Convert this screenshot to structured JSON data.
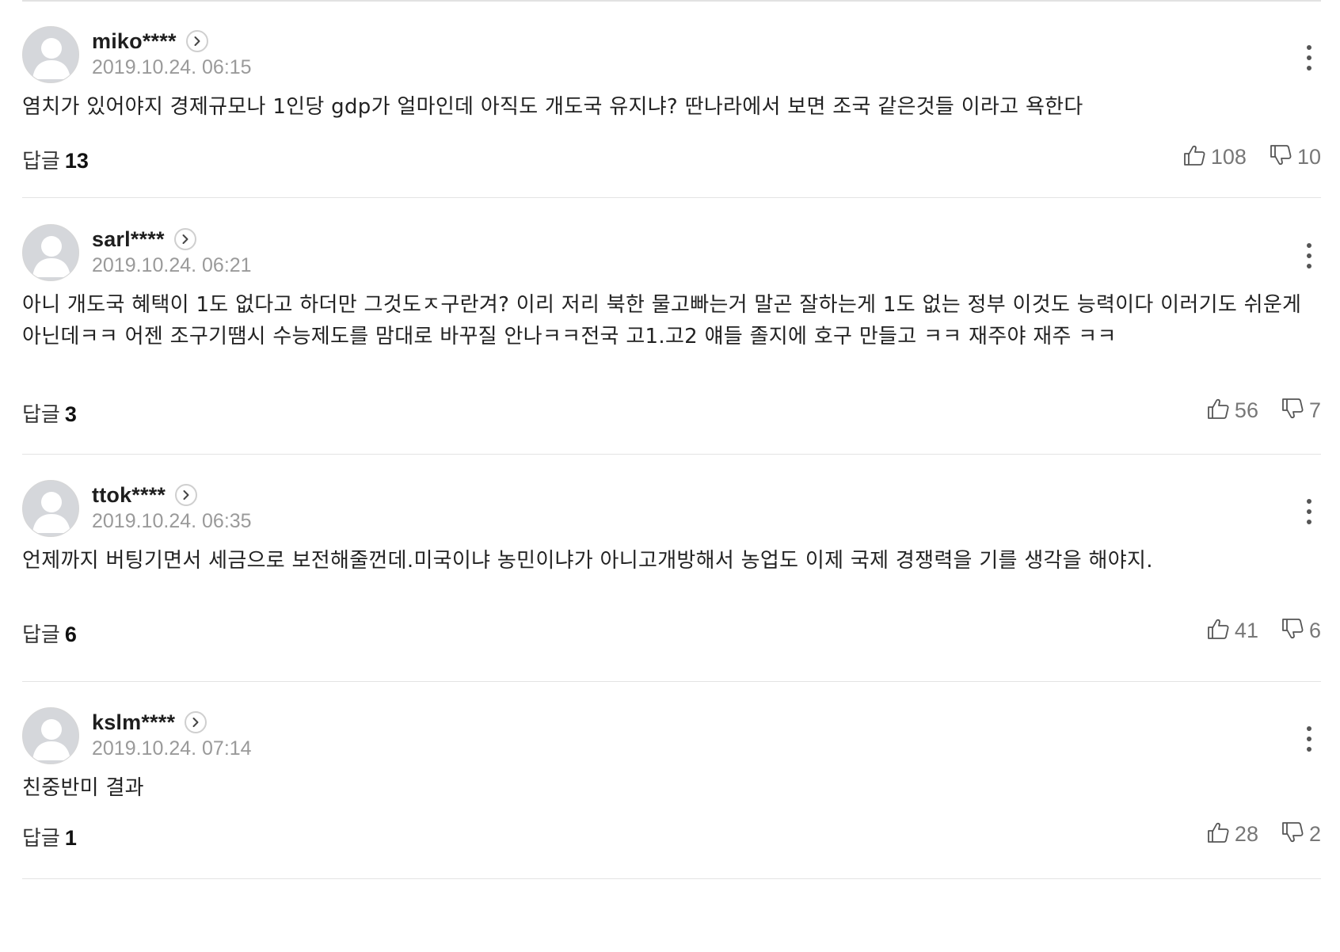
{
  "comments": [
    {
      "username": "miko****",
      "timestamp": "2019.10.24. 06:15",
      "text": "염치가 있어야지 경제규모나 1인당 gdp가 얼마인데 아직도 개도국 유지냐? 딴나라에서 보면 조국 같은것들 이라고 욕한다",
      "reply_label": "답글",
      "reply_count": "13",
      "likes": "108",
      "dislikes": "10"
    },
    {
      "username": "sarl****",
      "timestamp": "2019.10.24. 06:21",
      "text": "아니 개도국 혜택이 1도 없다고 하더만 그것도ㅈ구란겨? 이리 저리 북한 물고빠는거 말곤 잘하는게 1도 없는 정부 이것도 능력이다 이러기도 쉬운게 아닌데ㅋㅋ 어젠 조구기땜시 수능제도를 맘대로 바꾸질 안나ㅋㅋ전국 고1.고2 얘들 졸지에 호구 만들고 ㅋㅋ 재주야 재주 ㅋㅋ",
      "reply_label": "답글",
      "reply_count": "3",
      "likes": "56",
      "dislikes": "7"
    },
    {
      "username": "ttok****",
      "timestamp": "2019.10.24. 06:35",
      "text": "언제까지 버팅기면서 세금으로 보전해줄껀데.미국이냐 농민이냐가 아니고개방해서 농업도 이제 국제 경쟁력을 기를 생각을 해야지.",
      "reply_label": "답글",
      "reply_count": "6",
      "likes": "41",
      "dislikes": "6"
    },
    {
      "username": "kslm****",
      "timestamp": "2019.10.24. 07:14",
      "text": "친중반미 결과",
      "reply_label": "답글",
      "reply_count": "1",
      "likes": "28",
      "dislikes": "2"
    }
  ],
  "icons": {
    "avatar": "default-user-avatar-icon",
    "profile": "chevron-right-circle-icon",
    "more": "vertical-ellipsis-icon",
    "like": "thumbs-up-icon",
    "dislike": "thumbs-down-icon"
  },
  "colors": {
    "text": "#222222",
    "timestamp": "#9a9a9a",
    "vote_count": "#777777",
    "divider": "#e4e4e4",
    "avatar_bg": "#d5d7db"
  }
}
